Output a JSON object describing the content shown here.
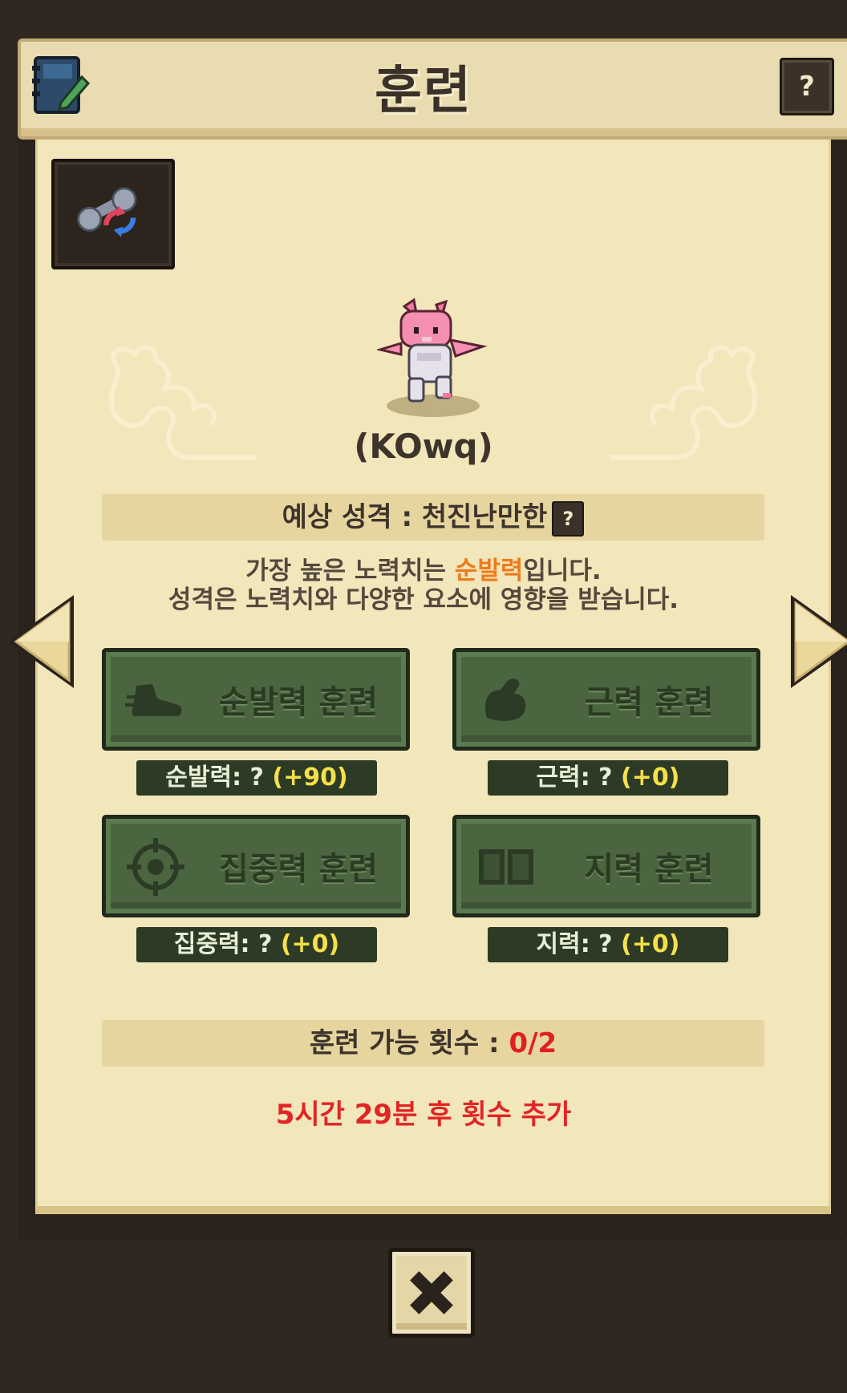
{
  "header": {
    "title": "훈련",
    "help_label": "?"
  },
  "character": {
    "name": "(KOwq)"
  },
  "personality": {
    "label": "예상 성격 : 천진난만한",
    "help_label": "?"
  },
  "description": {
    "line1_prefix": "가장 높은 노력치는 ",
    "line1_highlight": "순발력",
    "line1_suffix": "입니다.",
    "line2": "성격은 노력치와 다양한 요소에 영향을 받습니다."
  },
  "trainings": [
    {
      "label": "순발력 훈련",
      "stat_label": "순발력: ? ",
      "stat_value": "(+90)",
      "icon": "sneaker-icon"
    },
    {
      "label": "근력 훈련",
      "stat_label": "근력: ? ",
      "stat_value": "(+0)",
      "icon": "muscle-arm-icon"
    },
    {
      "label": "집중력 훈련",
      "stat_label": "집중력: ? ",
      "stat_value": "(+0)",
      "icon": "crosshair-icon"
    },
    {
      "label": "지력 훈련",
      "stat_label": "지력: ? ",
      "stat_value": "(+0)",
      "icon": "open-book-icon"
    }
  ],
  "count": {
    "label": "훈련 가능 횟수 : ",
    "value": "0/2"
  },
  "timer": "5시간 29분 후 횟수 추가",
  "colors": {
    "panel": "#f2e6bb",
    "button_green": "#4b6540",
    "highlight_orange": "#f07a1a",
    "alert_red": "#e02525",
    "stat_yellow": "#f5e04a"
  }
}
